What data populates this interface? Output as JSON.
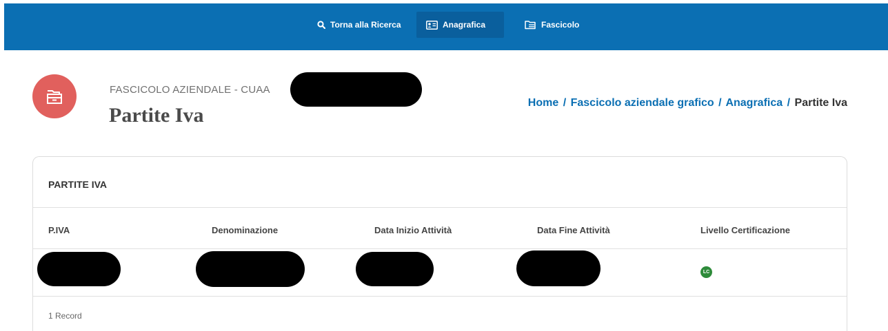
{
  "nav": {
    "search_label": "Torna alla Ricerca",
    "anagrafica_label": "Anagrafica",
    "fascicolo_label": "Fascicolo"
  },
  "header": {
    "subtitle": "FASCICOLO AZIENDALE - CUAA",
    "title": "Partite Iva"
  },
  "breadcrumb": {
    "home": "Home",
    "grafico": "Fascicolo aziendale grafico",
    "anagrafica": "Anagrafica",
    "current": "Partite Iva",
    "separator": "/"
  },
  "table": {
    "title": "PARTITE IVA",
    "columns": [
      "P.IVA",
      "Denominazione",
      "Data Inizio Attività",
      "Data Fine Attività",
      "Livello Certificazione"
    ],
    "rows": [
      {
        "certification_badge": "LC"
      }
    ],
    "record_count": "1 Record"
  },
  "colors": {
    "primary": "#0B6FB3",
    "icon_bg": "#E1605D",
    "badge_green": "#2E8B3A"
  }
}
